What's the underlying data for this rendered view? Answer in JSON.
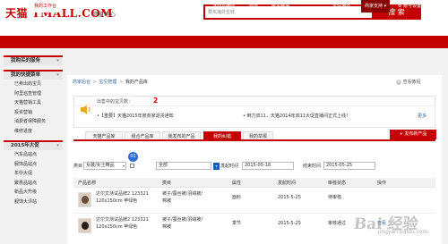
{
  "header": {
    "logo": "天猫 TMALL.COM",
    "subtitle": "商家中心",
    "search_value": "要买海外生鲜",
    "search_button": "搜 索"
  },
  "nav": {
    "items": [
      "首页",
      "我的工作台",
      "商家成长",
      "天猫智库",
      "天猫学习库",
      "天猫规则",
      "活动直播间",
      "商盟",
      "喵言喵语",
      "炎任海外",
      "商家支持 ▾",
      "账号设置"
    ],
    "active_index": 1
  },
  "sidebar": {
    "sections": [
      {
        "title": "我购买的服务",
        "items": []
      },
      {
        "title": "我的快捷菜单",
        "items": [
          "已卖出的宝贝",
          "阿里巡查管理",
          "天猫营销工具",
          "投资营销",
          "消费者保障服务",
          "维修进度"
        ]
      },
      {
        "title": "2015年大促",
        "items": [
          "汽车品站点",
          "服饰品站点",
          "年中大促",
          "聚惠品站点",
          "新品大升级",
          "服饰大评站"
        ]
      }
    ]
  },
  "breadcrumb": {
    "items": [
      "商家后台",
      "宝贝管理",
      "我的产品库"
    ],
    "separator": ">"
  },
  "help_link": "查看教程",
  "notice": {
    "selling_label": "出售中的宝贝数：",
    "selling_count": "2",
    "line1": "•【重要】天猫2015年度商家退货通知",
    "line2": "• 倒力双11，天猫2014年双11大促直播间正式上线！",
    "more": "更多"
  },
  "tabs": {
    "items": [
      "天猫产品库",
      "组合产品库",
      "我发布的产品",
      "我的纠错",
      "我的举报"
    ],
    "active_index": 3
  },
  "publish_button": "+ 发布新产品",
  "filters": {
    "category_label": "类目",
    "category_value": "女装/女士精品",
    "all_option": "全部",
    "badge": "01",
    "time_label": "发起时间",
    "start_date": "2015-05-18",
    "end_label": "结束时间",
    "end_date": "2015-05-25"
  },
  "table": {
    "headers": [
      "产品名称",
      "类目",
      "属性",
      "发起时间",
      "审核状态",
      "操作"
    ],
    "rows": [
      {
        "name_line1": "达尔文测试品牌2 123321",
        "name_line2": "120x150cm 苹绿色",
        "category_line1": "被子/蚕丝被/羽绒被/",
        "category_line2": "棉被",
        "attribute": "面料",
        "time": "2015-5-25",
        "status": "待审核",
        "action": ""
      },
      {
        "name_line1": "达尔文测试品牌2 123321",
        "name_line2": "120x150cm 苹绿色",
        "category_line1": "被子/蚕丝被/羽绒被/",
        "category_line2": "棉被",
        "attribute": "季节",
        "time": "2015-5-25",
        "status": "审核通过",
        "action": "查看"
      }
    ]
  },
  "watermark": {
    "main": "Bai 经验",
    "sub": "jingyan.baidu.com"
  },
  "colors": {
    "brand_red": "#c40000",
    "link_blue": "#336699",
    "badge_blue": "#2b6fd6"
  }
}
